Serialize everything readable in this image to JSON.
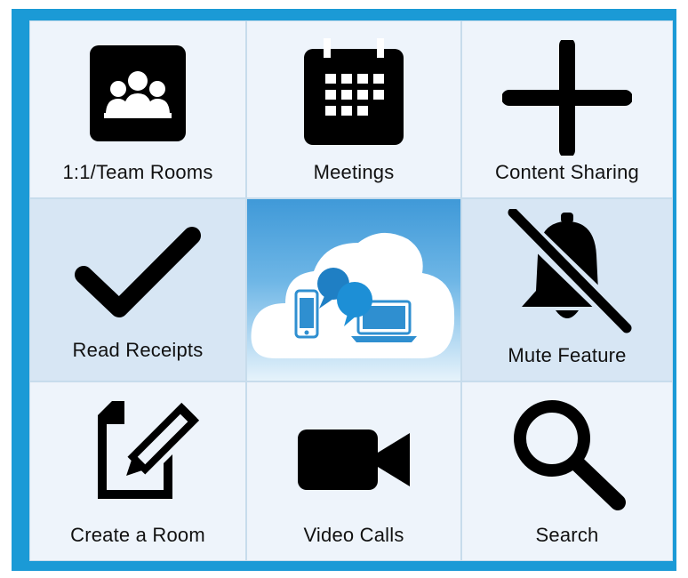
{
  "tiles": {
    "team_rooms": "1:1/Team Rooms",
    "meetings": "Meetings",
    "content_sharing": "Content Sharing",
    "read_receipts": "Read Receipts",
    "mute_feature": "Mute Feature",
    "create_room": "Create a Room",
    "video_calls": "Video Calls",
    "search": "Search"
  },
  "icons": {
    "team_rooms": "people-group-icon",
    "meetings": "calendar-icon",
    "content_sharing": "plus-icon",
    "read_receipts": "checkmark-icon",
    "center": "cloud-devices-chat-icon",
    "mute_feature": "bell-muted-icon",
    "create_room": "edit-document-icon",
    "video_calls": "video-camera-icon",
    "search": "search-icon"
  },
  "colors": {
    "frame": "#1b9ad6",
    "tile": "#eef4fb",
    "tile_tinted": "#d7e6f4",
    "icon": "#000000"
  }
}
